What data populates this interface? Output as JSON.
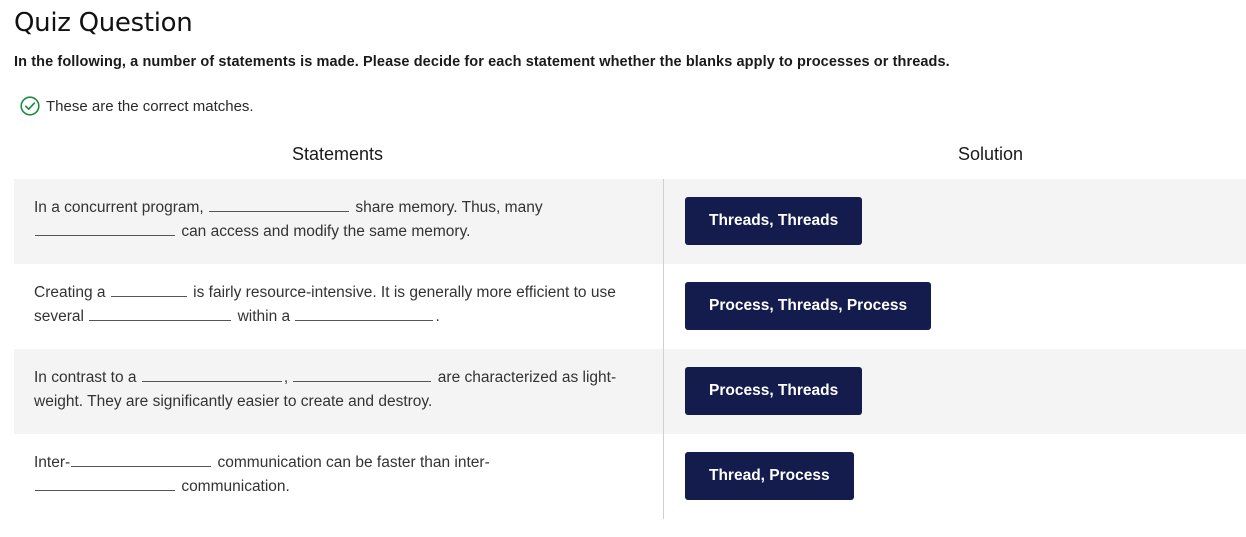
{
  "title": "Quiz Question",
  "instructions": "In the following, a number of statements is made. Please decide for each statement whether the blanks apply to processes or threads.",
  "feedback": {
    "text": "These are the correct matches.",
    "icon": "check-circle-icon",
    "icon_color": "#1e8a44"
  },
  "headers": {
    "statements": "Statements",
    "solution": "Solution"
  },
  "accent_color": "#141b4d",
  "rows": [
    {
      "seg": [
        "In a concurrent program,",
        "share memory. Thus, many",
        "can access and modify the same memory."
      ],
      "solution": "Threads, Threads"
    },
    {
      "seg": [
        "Creating a",
        "is fairly resource-intensive. It is generally more efficient to use several",
        "within a",
        "."
      ],
      "solution": "Process, Threads, Process"
    },
    {
      "seg": [
        "In contrast to a",
        ",",
        "are characterized as light-weight. They are significantly easier to create and destroy."
      ],
      "solution": "Process, Threads"
    },
    {
      "seg": [
        "Inter-",
        "communication can be faster than inter-",
        "communication."
      ],
      "solution": "Thread, Process"
    }
  ]
}
